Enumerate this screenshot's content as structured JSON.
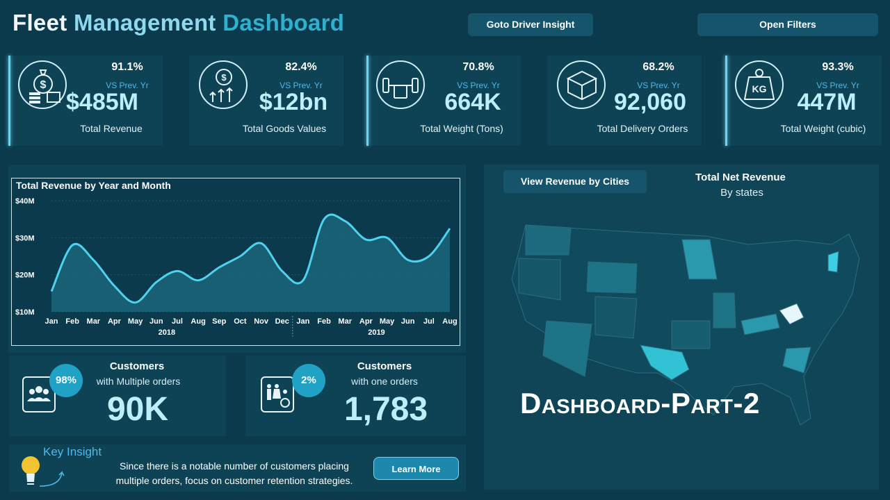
{
  "header": {
    "title_part1": "Fleet",
    "title_part2": "Management",
    "title_part3": "Dashboard",
    "driver_button": "Goto Driver Insight",
    "filters_button": "Open Filters"
  },
  "kpis": [
    {
      "icon": "money-bag-icon",
      "percent": "91.1%",
      "vs_label": "VS Prev. Yr",
      "value": "$485M",
      "label": "Total Revenue"
    },
    {
      "icon": "dollar-growth-icon",
      "percent": "82.4%",
      "vs_label": "VS Prev. Yr",
      "value": "$12bn",
      "label": "Total Goods Values"
    },
    {
      "icon": "dumbbell-icon",
      "percent": "70.8%",
      "vs_label": "VS Prev. Yr",
      "value": "664K",
      "label": "Total Weight (Tons)"
    },
    {
      "icon": "boxes-icon",
      "percent": "68.2%",
      "vs_label": "VS Prev. Yr",
      "value": "92,060",
      "label": "Total Delivery Orders"
    },
    {
      "icon": "kg-weight-icon",
      "percent": "93.3%",
      "vs_label": "VS Prev. Yr",
      "value": "447M",
      "label": "Total Weight (cubic)"
    }
  ],
  "chart_data": {
    "type": "area",
    "title": "Total Revenue by Year and Month",
    "x": [
      "Jan",
      "Feb",
      "Mar",
      "Apr",
      "May",
      "Jun",
      "Jul",
      "Aug",
      "Sep",
      "Oct",
      "Nov",
      "Dec",
      "Jan",
      "Feb",
      "Mar",
      "Apr",
      "May",
      "Jun",
      "Jul",
      "Aug"
    ],
    "year_groups": [
      {
        "label": "2018",
        "start": 0,
        "end": 11
      },
      {
        "label": "2019",
        "start": 12,
        "end": 19
      }
    ],
    "values": [
      15.5,
      28,
      24,
      17,
      12.5,
      18,
      21,
      18.5,
      22,
      25,
      28.5,
      21,
      18.5,
      35,
      34.5,
      29.5,
      30,
      24,
      25,
      32.5
    ],
    "y_ticks": [
      "$10M",
      "$20M",
      "$30M",
      "$40M"
    ],
    "ylim": [
      10,
      40
    ],
    "color": "#4fd1f0"
  },
  "map": {
    "button": "View Revenue by Cities",
    "title": "Total Net Revenue",
    "subtitle": "By states"
  },
  "customers": [
    {
      "badge": "98%",
      "icon": "people-group-icon",
      "title": "Customers",
      "subtitle": "with Multiple orders",
      "value": "90K"
    },
    {
      "badge": "2%",
      "icon": "family-icon",
      "title": "Customers",
      "subtitle": "with one orders",
      "value": "1,783"
    }
  ],
  "insight": {
    "title": "Key Insight",
    "text_line1": "Since there is a notable number of customers placing",
    "text_line2": "multiple orders, focus on customer retention strategies.",
    "button": "Learn More"
  },
  "overlay_text": "Dashboard-Part-2"
}
